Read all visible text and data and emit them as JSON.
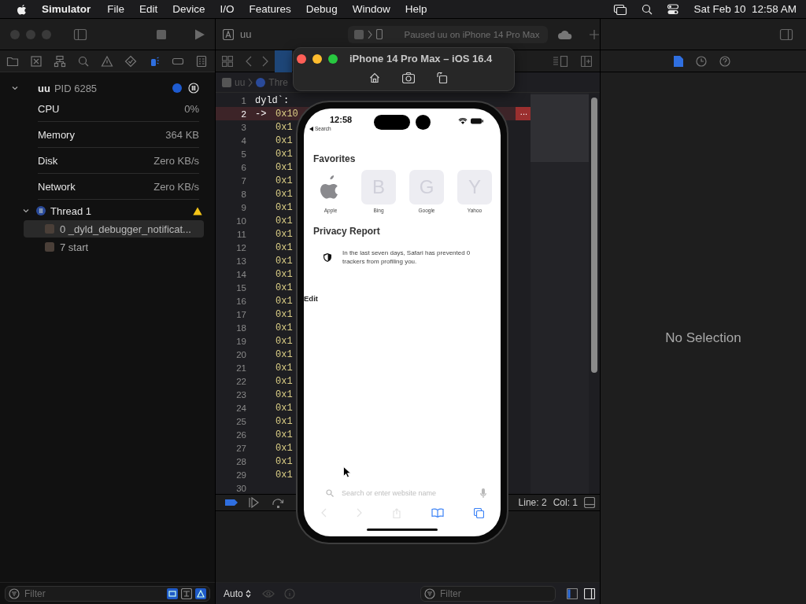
{
  "menu_bar": {
    "app": "Simulator",
    "menus": [
      "File",
      "Edit",
      "Device",
      "I/O",
      "Features",
      "Debug",
      "Window",
      "Help"
    ],
    "clock": "Sat Feb 10  12:58 AM"
  },
  "toolbar": {
    "scheme": "uu",
    "status": "Paused uu on iPhone 14 Pro Max"
  },
  "navigator_tabs": [
    {
      "selected": false
    },
    {
      "selected": false
    },
    {
      "selected": false
    },
    {
      "selected": false
    },
    {
      "selected": false
    },
    {
      "selected": false
    },
    {
      "selected": true
    },
    {
      "selected": false
    },
    {
      "selected": false
    }
  ],
  "debug_navigator": {
    "process": {
      "name": "uu",
      "pid": "PID 6285",
      "expanded": true
    },
    "gauges": [
      {
        "label": "CPU",
        "value": "0%"
      },
      {
        "label": "Memory",
        "value": "364 KB"
      },
      {
        "label": "Disk",
        "value": "Zero KB/s"
      },
      {
        "label": "Network",
        "value": "Zero KB/s"
      }
    ],
    "thread": {
      "name": "Thread 1",
      "expanded": true
    },
    "frames": [
      {
        "label": "0 _dyld_debugger_notificat...",
        "selected": true
      },
      {
        "label": "7 start",
        "selected": false
      }
    ],
    "filter": {
      "placeholder": "Filter"
    }
  },
  "editor": {
    "breadcrumb": [
      "uu",
      "Thre"
    ],
    "lines": [
      {
        "number": "1",
        "kind": "label",
        "text": "dyld`:",
        "current": false
      },
      {
        "number": "2",
        "kind": "instruction",
        "marker": "->",
        "text": "0x10",
        "tail": "...",
        "current": true
      },
      {
        "number": "3",
        "kind": "instruction",
        "text": "0x1",
        "current": false
      },
      {
        "number": "4",
        "kind": "instruction",
        "text": "0x1",
        "current": false
      },
      {
        "number": "5",
        "kind": "instruction",
        "text": "0x1",
        "current": false
      },
      {
        "number": "6",
        "kind": "instruction",
        "text": "0x1",
        "current": false
      },
      {
        "number": "7",
        "kind": "instruction",
        "text": "0x1",
        "current": false
      },
      {
        "number": "8",
        "kind": "instruction",
        "text": "0x1",
        "current": false
      },
      {
        "number": "9",
        "kind": "instruction",
        "text": "0x1",
        "current": false
      },
      {
        "number": "10",
        "kind": "instruction",
        "text": "0x1",
        "current": false
      },
      {
        "number": "11",
        "kind": "instruction",
        "text": "0x1",
        "current": false
      },
      {
        "number": "12",
        "kind": "instruction",
        "text": "0x1",
        "current": false
      },
      {
        "number": "13",
        "kind": "instruction",
        "text": "0x1",
        "current": false
      },
      {
        "number": "14",
        "kind": "instruction",
        "text": "0x1",
        "current": false
      },
      {
        "number": "15",
        "kind": "instruction",
        "text": "0x1",
        "current": false
      },
      {
        "number": "16",
        "kind": "instruction",
        "text": "0x1",
        "current": false
      },
      {
        "number": "17",
        "kind": "instruction",
        "text": "0x1",
        "current": false
      },
      {
        "number": "18",
        "kind": "instruction",
        "text": "0x1",
        "current": false
      },
      {
        "number": "19",
        "kind": "instruction",
        "text": "0x1",
        "current": false
      },
      {
        "number": "20",
        "kind": "instruction",
        "text": "0x1",
        "current": false
      },
      {
        "number": "21",
        "kind": "instruction",
        "text": "0x1",
        "current": false
      },
      {
        "number": "22",
        "kind": "instruction",
        "text": "0x1",
        "current": false
      },
      {
        "number": "23",
        "kind": "instruction",
        "text": "0x1",
        "current": false
      },
      {
        "number": "24",
        "kind": "instruction",
        "text": "0x1",
        "current": false
      },
      {
        "number": "25",
        "kind": "instruction",
        "text": "0x1",
        "current": false
      },
      {
        "number": "26",
        "kind": "instruction",
        "text": "0x1",
        "current": false
      },
      {
        "number": "27",
        "kind": "instruction",
        "text": "0x1",
        "current": false
      },
      {
        "number": "28",
        "kind": "instruction",
        "text": "0x1",
        "current": false
      },
      {
        "number": "29",
        "kind": "instruction",
        "text": "0x1",
        "current": false
      },
      {
        "number": "30",
        "kind": "instruction",
        "current": false
      }
    ],
    "position": [
      "Line: 2",
      "Col: 1"
    ]
  },
  "console": {
    "mode": "Auto",
    "filter": {
      "placeholder": "Filter"
    }
  },
  "inspector": {
    "empty_text": "No Selection"
  },
  "simulator": {
    "title": "iPhone 14 Pro Max – iOS 16.4",
    "phone": {
      "time": "12:58",
      "back_label": "Search",
      "favorites_title": "Favorites",
      "favorites": [
        {
          "label": "Apple",
          "kind": "icon"
        },
        {
          "label": "Bing",
          "kind": "letter",
          "letter": "B"
        },
        {
          "label": "Google",
          "kind": "letter",
          "letter": "G"
        },
        {
          "label": "Yahoo",
          "kind": "letter",
          "letter": "Y"
        }
      ],
      "privacy_title": "Privacy Report",
      "privacy_text": "In the last seven days, Safari has prevented 0 trackers from profiling you.",
      "edit_label": "Edit",
      "search_placeholder": "Search or enter website name"
    }
  }
}
